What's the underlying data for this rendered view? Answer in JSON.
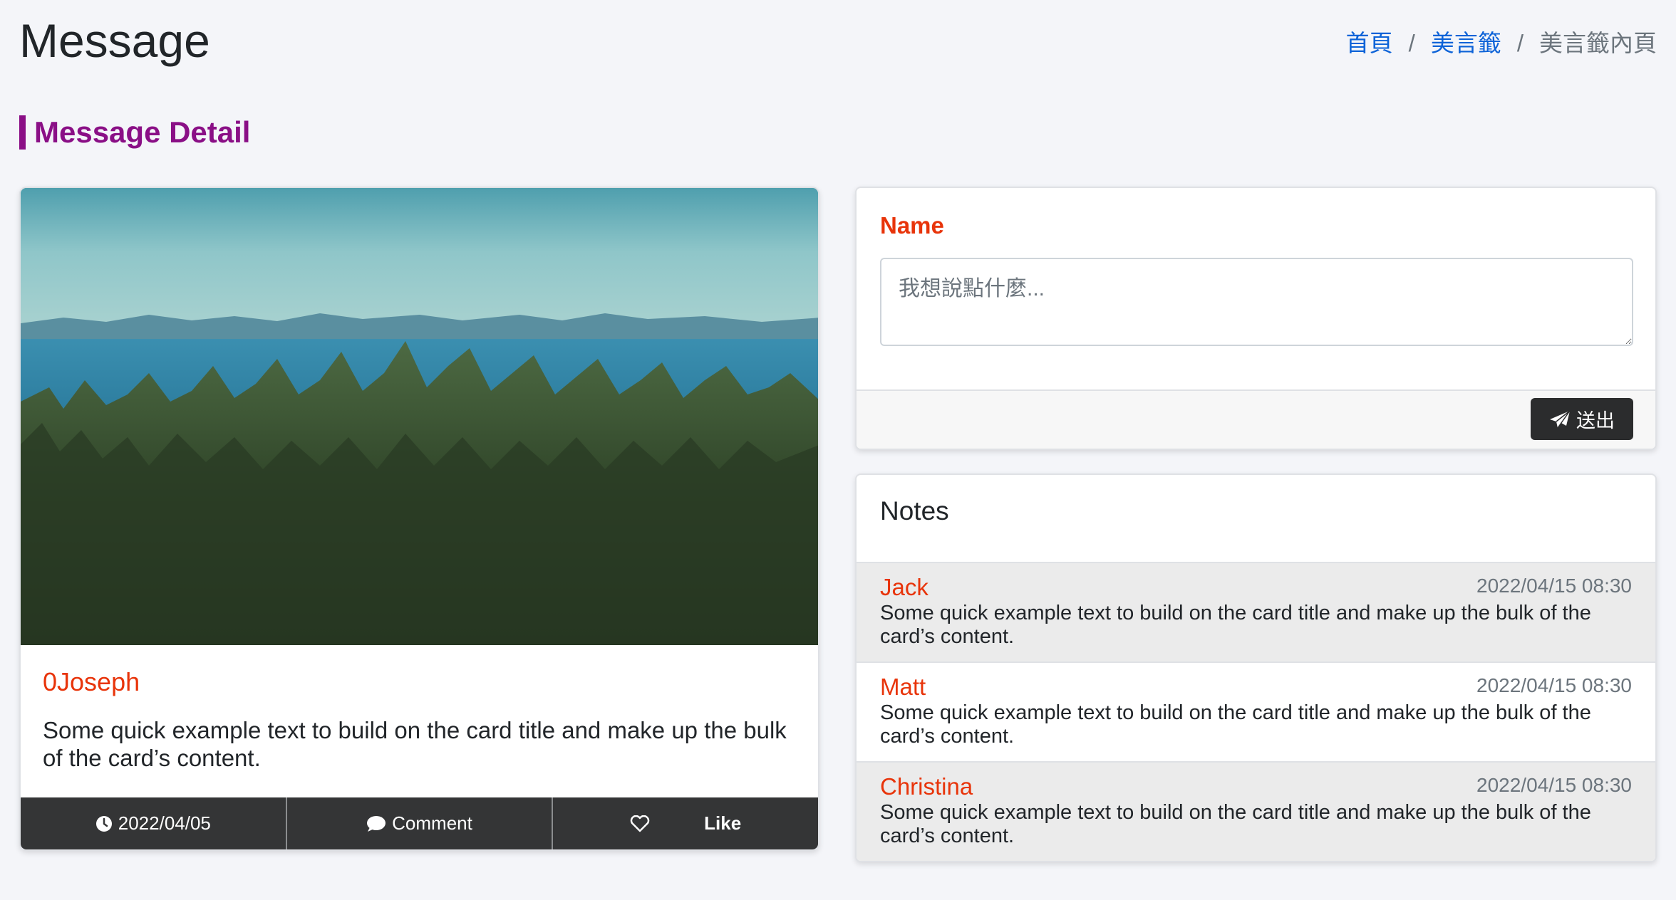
{
  "header": {
    "title": "Message",
    "breadcrumb": {
      "home": "首頁",
      "quotes": "美言籤",
      "current": "美言籤內頁",
      "separator": "/"
    }
  },
  "section": {
    "title": "Message Detail"
  },
  "post": {
    "author": "0Joseph",
    "text": "Some quick example text to build on the card title and make up the bulk of the card’s content.",
    "footer": {
      "date": "2022/04/05",
      "comment_label": "Comment",
      "like_label": "Like"
    }
  },
  "compose": {
    "label": "Name",
    "placeholder": "我想說點什麼...",
    "send_label": "送出"
  },
  "notes": {
    "title": "Notes",
    "items": [
      {
        "name": "Jack",
        "time": "2022/04/15 08:30",
        "text": "Some quick example text to build on the card title and make up the bulk of the card’s content."
      },
      {
        "name": "Matt",
        "time": "2022/04/15 08:30",
        "text": "Some quick example text to build on the card title and make up the bulk of the card’s content."
      },
      {
        "name": "Christina",
        "time": "2022/04/15 08:30",
        "text": "Some quick example text to build on the card title and make up the bulk of the card’s content."
      }
    ]
  },
  "colors": {
    "accent_purple": "#8a0f86",
    "name_red": "#e8340a",
    "link_blue": "#0d63d8",
    "dark_bar": "#343536"
  },
  "icons": {
    "date": "clock-icon",
    "comment": "comment-icon",
    "like": "heart-icon",
    "send": "paper-plane-icon"
  }
}
